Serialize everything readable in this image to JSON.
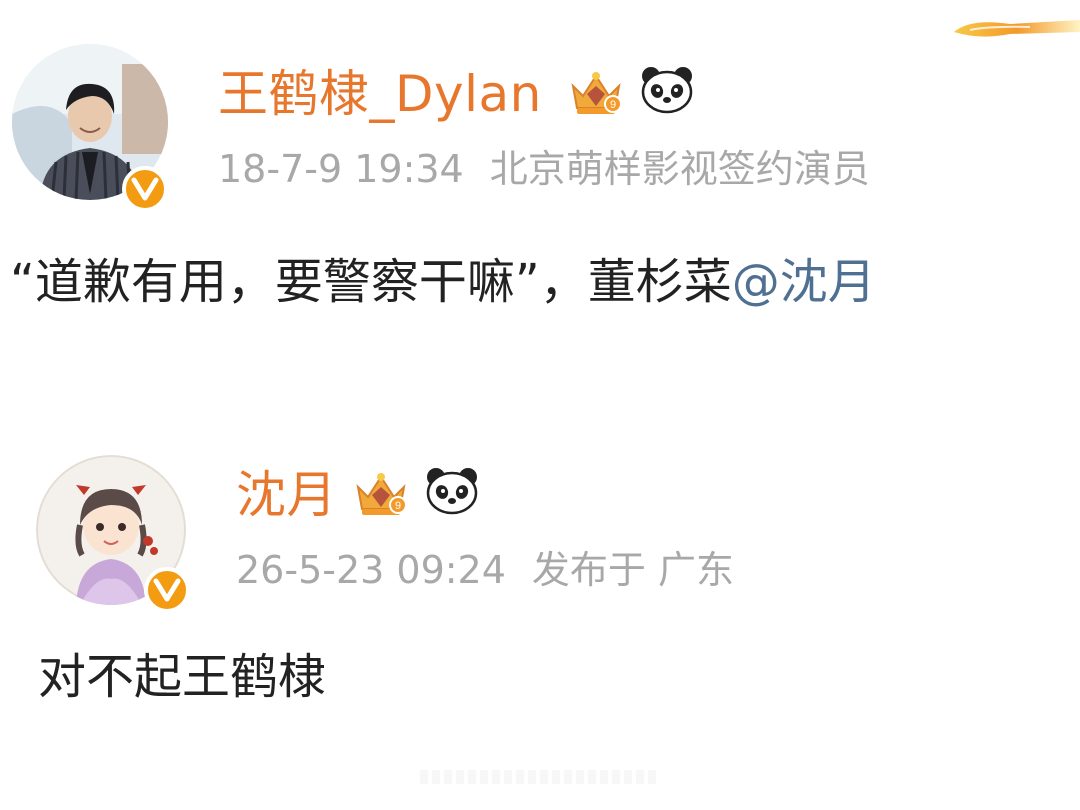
{
  "posts": [
    {
      "username": "王鹤棣_Dylan",
      "timestamp": "18-7-9 19:34",
      "meta_detail": "北京萌样影视签约演员",
      "content_text": "“道歉有用，要警察干嘛”，董杉菜",
      "mention": "@沈月",
      "badges": [
        "crown-badge-icon",
        "panda-icon"
      ],
      "verified": true
    },
    {
      "username": "沈月",
      "timestamp": "26-5-23 09:24",
      "meta_detail": "发布于 广东",
      "content_text": "对不起王鹤棣",
      "badges": [
        "crown-badge-icon",
        "panda-icon"
      ],
      "verified": true
    }
  ],
  "colors": {
    "username": "#e8772e",
    "meta": "#a8a8a8",
    "mention": "#4f6f93",
    "verified": "#f39c12",
    "text": "#222222"
  }
}
